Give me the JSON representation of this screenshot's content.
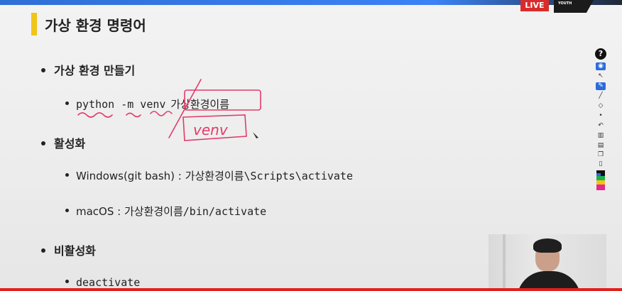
{
  "header": {
    "live_label": "LIVE",
    "brand_label": "YOUTH"
  },
  "slide": {
    "title": "가상 환경 명령어",
    "sections": [
      {
        "heading": "가상 환경 만들기"
      },
      {
        "heading": "활성화"
      },
      {
        "heading": "비활성화"
      }
    ],
    "items": {
      "create_cmd_code": "python -m venv",
      "create_cmd_name": "가상환경이름",
      "windows_label": "Windows(git bash) : ",
      "windows_name": "가상환경이름",
      "windows_path": "\\Scripts\\activate",
      "mac_label": "macOS : ",
      "mac_name": "가상환경이름",
      "mac_path": "/bin/activate",
      "deactivate_cmd": "deactivate"
    },
    "handwriting": {
      "box_text": "venv"
    }
  },
  "annotation_toolbar": {
    "help_label": "?",
    "tools": [
      "eye-icon",
      "cursor-icon",
      "pen-icon",
      "marker-icon",
      "eraser-icon",
      "dot-icon",
      "undo-icon",
      "trash-icon",
      "save-icon",
      "copy-icon",
      "clipboard-icon"
    ],
    "colors": [
      "#111111",
      "#2b6cd9",
      "#19b34a",
      "#f4c21a",
      "#e0201f",
      "#e32a8f"
    ]
  },
  "colors": {
    "accent": "#f0c419",
    "ink": "#e23b6a",
    "live": "#d92b2b"
  }
}
